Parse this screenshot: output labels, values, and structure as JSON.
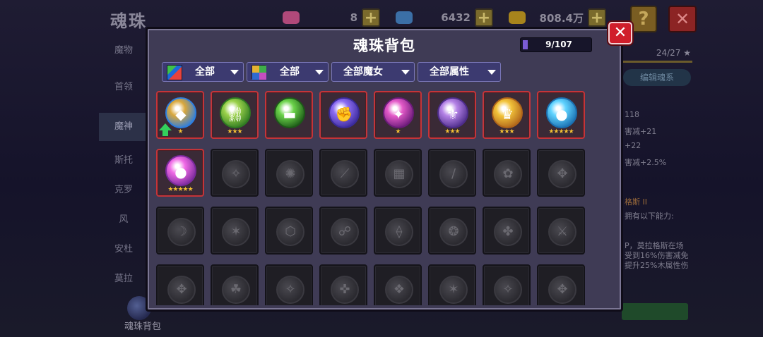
{
  "background": {
    "page_title": "魂珠",
    "resources": [
      {
        "name": "pink-gem",
        "value": "8",
        "color": "#b0497a"
      },
      {
        "name": "blue-diamond",
        "value": "6432",
        "color": "#3b6fa6"
      },
      {
        "name": "gold-coin",
        "value": "808.4万",
        "color": "#a7841c"
      }
    ],
    "help_label": "?",
    "close_label": "✕",
    "sidebar": [
      {
        "label": "魔物",
        "active": false
      },
      {
        "label": "首领",
        "active": false
      },
      {
        "label": "魔神",
        "active": true
      },
      {
        "label": "斯托",
        "active": false
      },
      {
        "label": "克罗",
        "active": false
      },
      {
        "label": "风",
        "active": false
      },
      {
        "label": "安杜",
        "active": false
      },
      {
        "label": "莫拉",
        "active": false
      }
    ],
    "soul_bag_label": "魂珠背包",
    "right_panel": {
      "count": "24/27 ★",
      "edit_label": "编辑魂系",
      "stats": [
        "118",
        "害减+21",
        "+22",
        "害减+2.5%"
      ],
      "skill_name": "格斯 II",
      "skill_intro": "拥有以下能力:",
      "skill_desc": [
        "P，莫拉格斯在场",
        "受到16%伤害减免",
        "提升25%木属性伤"
      ]
    }
  },
  "modal": {
    "title": "魂珠背包",
    "capacity": {
      "text": "9/107",
      "used": 9,
      "total": 107
    },
    "close_label": "✕",
    "filters": [
      {
        "label": "全部",
        "icon": "rainbow-icon"
      },
      {
        "label": "全部",
        "icon": "element-grid-icon"
      },
      {
        "label": "全部魔女",
        "icon": ""
      },
      {
        "label": "全部属性",
        "icon": ""
      }
    ],
    "filled_orbs": [
      {
        "name": "blue-crystal-orb",
        "stars": "★",
        "color_a": "#d9a73b",
        "color_b": "#2d7ee0",
        "glyph": "◆",
        "upgrade": true
      },
      {
        "name": "green-chain-orb",
        "stars": "★★★",
        "color_a": "#9ad14a",
        "color_b": "#2f7a22",
        "glyph": "⛓",
        "upgrade": false
      },
      {
        "name": "green-cannon-orb",
        "stars": "",
        "color_a": "#6bd34a",
        "color_b": "#1d5a18",
        "glyph": "▬",
        "upgrade": false
      },
      {
        "name": "purple-fist-orb",
        "stars": "",
        "color_a": "#8c6cf2",
        "color_b": "#3a2a9a",
        "glyph": "✊",
        "upgrade": false
      },
      {
        "name": "magenta-sigil-orb",
        "stars": "★",
        "color_a": "#e35ac8",
        "color_b": "#6b1b7a",
        "glyph": "✦",
        "upgrade": false
      },
      {
        "name": "violet-crest-orb",
        "stars": "★★★",
        "color_a": "#b482e6",
        "color_b": "#4d2c8a",
        "glyph": "⚜",
        "upgrade": false
      },
      {
        "name": "gold-crest-orb",
        "stars": "★★★",
        "color_a": "#f2c33a",
        "color_b": "#b0651a",
        "glyph": "♛",
        "upgrade": false
      },
      {
        "name": "cyan-bubble-orb",
        "stars": "★★★★★",
        "color_a": "#5fd3ff",
        "color_b": "#1a6fb0",
        "glyph": "●",
        "upgrade": false
      },
      {
        "name": "pink-bubble-orb",
        "stars": "★★★★★",
        "color_a": "#f06ae6",
        "color_b": "#7a2a9c",
        "glyph": "●",
        "upgrade": false
      }
    ],
    "empty_slot_glyphs": [
      "✧",
      "✺",
      "⟋",
      "▦",
      "∕",
      "✿",
      "✥",
      "☽",
      "✶",
      "⬡",
      "☍",
      "⟠",
      "❂",
      "✤",
      "⚔",
      "✥",
      "☘",
      "✧",
      "✜",
      "❖",
      "✶",
      "✧",
      "✥"
    ]
  }
}
